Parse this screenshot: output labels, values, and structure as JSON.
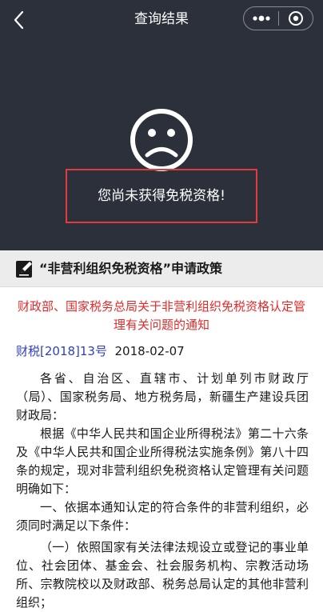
{
  "nav": {
    "title": "查询结果"
  },
  "result": {
    "message": "您尚未获得免税资格!"
  },
  "policy": {
    "section_title": "“非营利组织免税资格”申请政策"
  },
  "document": {
    "title": "财政部、国家税务总局关于非营利组织免税资格认定管理有关问题的通知",
    "doc_number": "财税[2018]13号",
    "date": "2018-02-07",
    "paragraphs": [
      "各省、自治区、直辖市、计划单列市财政厅（局）、国家税务局、地方税务局，新疆生产建设兵团财政局：",
      "根据《中华人民共和国企业所得税法》第二十六条及《中华人民共和国企业所得税法实施条例》第八十四条的规定，现对非营利组织免税资格认定管理有关问题明确如下：",
      "一、依据本通知认定的符合条件的非营利组织，必须同时满足以下条件：",
      "（一）依照国家有关法律法规设立或登记的事业单位、社会团体、基金会、社会服务机构、宗教活动场所、宗教院校以及财政部、税务总局认定的其他非营利组织；"
    ]
  },
  "colors": {
    "hero_bg": "#2b303b",
    "highlight_border": "#e23b3b",
    "doc_title": "#e02b2b",
    "doc_number": "#2e3fbf"
  },
  "icons": {
    "back": "chevron-left-icon",
    "more": "more-dots-icon",
    "close": "target-circle-icon",
    "face": "sad-face-icon",
    "policy": "edit-note-icon"
  }
}
